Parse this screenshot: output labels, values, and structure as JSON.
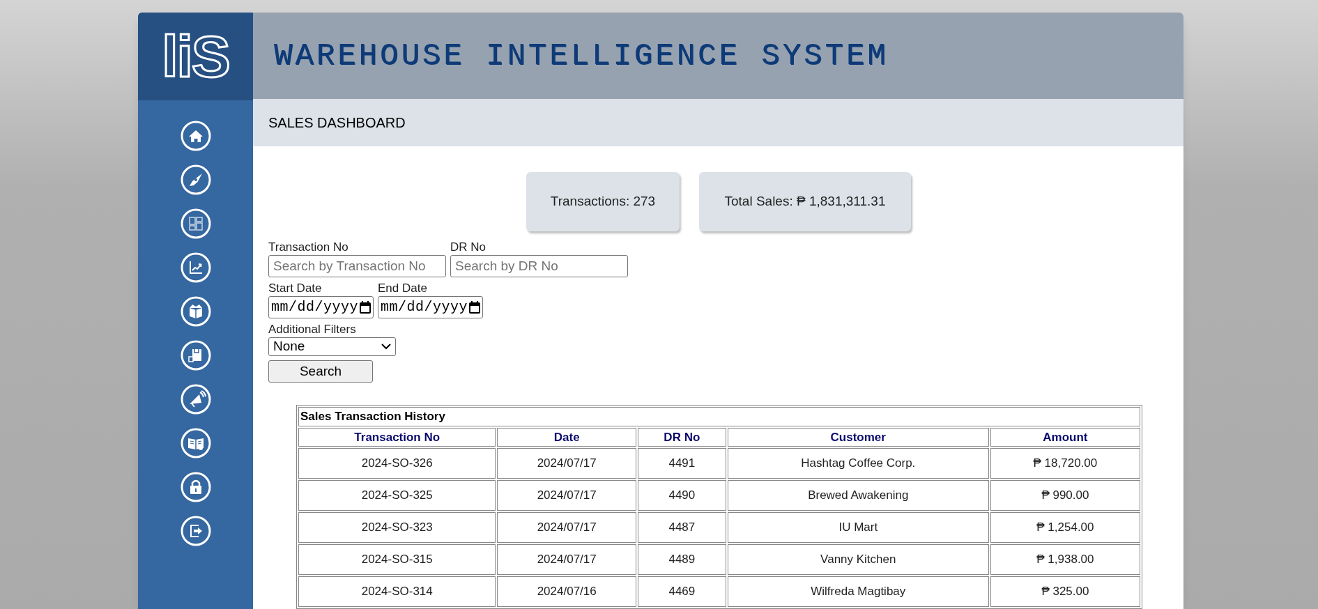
{
  "logo": {
    "text": "liS"
  },
  "header": {
    "title": "WAREHOUSE INTELLIGENCE SYSTEM"
  },
  "page_title": "SALES DASHBOARD",
  "stats": [
    {
      "text": "Transactions: 273"
    },
    {
      "text": "Total Sales: ₱ 1,831,311.31"
    }
  ],
  "filters": {
    "transaction_no": {
      "label": "Transaction No",
      "placeholder": "Search by Transaction No"
    },
    "dr_no": {
      "label": "DR No",
      "placeholder": "Search by DR No"
    },
    "start_date": {
      "label": "Start Date",
      "value": "mm/dd/yyyy"
    },
    "end_date": {
      "label": "End Date",
      "value": "mm/dd/yyyy"
    },
    "additional": {
      "label": "Additional Filters",
      "value": "None"
    },
    "search_button": "Search"
  },
  "table": {
    "caption": "Sales Transaction History",
    "columns": [
      "Transaction No",
      "Date",
      "DR No",
      "Customer",
      "Amount"
    ],
    "rows": [
      [
        "2024-SO-326",
        "2024/07/17",
        "4491",
        "Hashtag Coffee Corp.",
        "₱ 18,720.00"
      ],
      [
        "2024-SO-325",
        "2024/07/17",
        "4490",
        "Brewed Awakening",
        "₱ 990.00"
      ],
      [
        "2024-SO-323",
        "2024/07/17",
        "4487",
        "IU Mart",
        "₱ 1,254.00"
      ],
      [
        "2024-SO-315",
        "2024/07/17",
        "4489",
        "Vanny Kitchen",
        "₱ 1,938.00"
      ],
      [
        "2024-SO-314",
        "2024/07/16",
        "4469",
        "Wilfreda Magtibay",
        "₱ 325.00"
      ]
    ]
  }
}
